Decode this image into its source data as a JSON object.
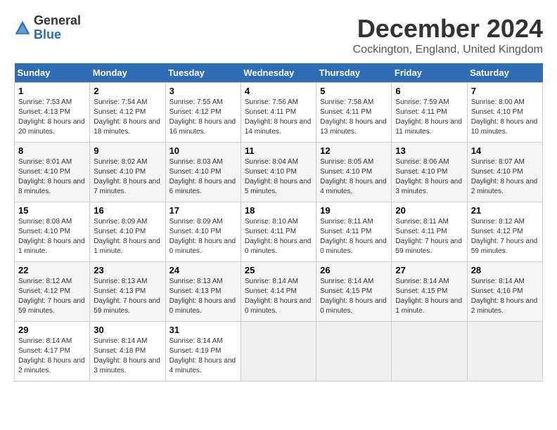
{
  "header": {
    "logo_general": "General",
    "logo_blue": "Blue",
    "month_title": "December 2024",
    "location": "Cockington, England, United Kingdom"
  },
  "days_of_week": [
    "Sunday",
    "Monday",
    "Tuesday",
    "Wednesday",
    "Thursday",
    "Friday",
    "Saturday"
  ],
  "weeks": [
    [
      {
        "day": "1",
        "sunrise": "Sunrise: 7:53 AM",
        "sunset": "Sunset: 4:13 PM",
        "daylight": "Daylight: 8 hours and 20 minutes."
      },
      {
        "day": "2",
        "sunrise": "Sunrise: 7:54 AM",
        "sunset": "Sunset: 4:12 PM",
        "daylight": "Daylight: 8 hours and 18 minutes."
      },
      {
        "day": "3",
        "sunrise": "Sunrise: 7:55 AM",
        "sunset": "Sunset: 4:12 PM",
        "daylight": "Daylight: 8 hours and 16 minutes."
      },
      {
        "day": "4",
        "sunrise": "Sunrise: 7:56 AM",
        "sunset": "Sunset: 4:11 PM",
        "daylight": "Daylight: 8 hours and 14 minutes."
      },
      {
        "day": "5",
        "sunrise": "Sunrise: 7:58 AM",
        "sunset": "Sunset: 4:11 PM",
        "daylight": "Daylight: 8 hours and 13 minutes."
      },
      {
        "day": "6",
        "sunrise": "Sunrise: 7:59 AM",
        "sunset": "Sunset: 4:11 PM",
        "daylight": "Daylight: 8 hours and 11 minutes."
      },
      {
        "day": "7",
        "sunrise": "Sunrise: 8:00 AM",
        "sunset": "Sunset: 4:10 PM",
        "daylight": "Daylight: 8 hours and 10 minutes."
      }
    ],
    [
      {
        "day": "8",
        "sunrise": "Sunrise: 8:01 AM",
        "sunset": "Sunset: 4:10 PM",
        "daylight": "Daylight: 8 hours and 8 minutes."
      },
      {
        "day": "9",
        "sunrise": "Sunrise: 8:02 AM",
        "sunset": "Sunset: 4:10 PM",
        "daylight": "Daylight: 8 hours and 7 minutes."
      },
      {
        "day": "10",
        "sunrise": "Sunrise: 8:03 AM",
        "sunset": "Sunset: 4:10 PM",
        "daylight": "Daylight: 8 hours and 6 minutes."
      },
      {
        "day": "11",
        "sunrise": "Sunrise: 8:04 AM",
        "sunset": "Sunset: 4:10 PM",
        "daylight": "Daylight: 8 hours and 5 minutes."
      },
      {
        "day": "12",
        "sunrise": "Sunrise: 8:05 AM",
        "sunset": "Sunset: 4:10 PM",
        "daylight": "Daylight: 8 hours and 4 minutes."
      },
      {
        "day": "13",
        "sunrise": "Sunrise: 8:06 AM",
        "sunset": "Sunset: 4:10 PM",
        "daylight": "Daylight: 8 hours and 3 minutes."
      },
      {
        "day": "14",
        "sunrise": "Sunrise: 8:07 AM",
        "sunset": "Sunset: 4:10 PM",
        "daylight": "Daylight: 8 hours and 2 minutes."
      }
    ],
    [
      {
        "day": "15",
        "sunrise": "Sunrise: 8:08 AM",
        "sunset": "Sunset: 4:10 PM",
        "daylight": "Daylight: 8 hours and 1 minute."
      },
      {
        "day": "16",
        "sunrise": "Sunrise: 8:09 AM",
        "sunset": "Sunset: 4:10 PM",
        "daylight": "Daylight: 8 hours and 1 minute."
      },
      {
        "day": "17",
        "sunrise": "Sunrise: 8:09 AM",
        "sunset": "Sunset: 4:10 PM",
        "daylight": "Daylight: 8 hours and 0 minutes."
      },
      {
        "day": "18",
        "sunrise": "Sunrise: 8:10 AM",
        "sunset": "Sunset: 4:11 PM",
        "daylight": "Daylight: 8 hours and 0 minutes."
      },
      {
        "day": "19",
        "sunrise": "Sunrise: 8:11 AM",
        "sunset": "Sunset: 4:11 PM",
        "daylight": "Daylight: 8 hours and 0 minutes."
      },
      {
        "day": "20",
        "sunrise": "Sunrise: 8:11 AM",
        "sunset": "Sunset: 4:11 PM",
        "daylight": "Daylight: 7 hours and 59 minutes."
      },
      {
        "day": "21",
        "sunrise": "Sunrise: 8:12 AM",
        "sunset": "Sunset: 4:12 PM",
        "daylight": "Daylight: 7 hours and 59 minutes."
      }
    ],
    [
      {
        "day": "22",
        "sunrise": "Sunrise: 8:12 AM",
        "sunset": "Sunset: 4:12 PM",
        "daylight": "Daylight: 7 hours and 59 minutes."
      },
      {
        "day": "23",
        "sunrise": "Sunrise: 8:13 AM",
        "sunset": "Sunset: 4:13 PM",
        "daylight": "Daylight: 7 hours and 59 minutes."
      },
      {
        "day": "24",
        "sunrise": "Sunrise: 8:13 AM",
        "sunset": "Sunset: 4:13 PM",
        "daylight": "Daylight: 8 hours and 0 minutes."
      },
      {
        "day": "25",
        "sunrise": "Sunrise: 8:14 AM",
        "sunset": "Sunset: 4:14 PM",
        "daylight": "Daylight: 8 hours and 0 minutes."
      },
      {
        "day": "26",
        "sunrise": "Sunrise: 8:14 AM",
        "sunset": "Sunset: 4:15 PM",
        "daylight": "Daylight: 8 hours and 0 minutes."
      },
      {
        "day": "27",
        "sunrise": "Sunrise: 8:14 AM",
        "sunset": "Sunset: 4:15 PM",
        "daylight": "Daylight: 8 hours and 1 minute."
      },
      {
        "day": "28",
        "sunrise": "Sunrise: 8:14 AM",
        "sunset": "Sunset: 4:16 PM",
        "daylight": "Daylight: 8 hours and 2 minutes."
      }
    ],
    [
      {
        "day": "29",
        "sunrise": "Sunrise: 8:14 AM",
        "sunset": "Sunset: 4:17 PM",
        "daylight": "Daylight: 8 hours and 2 minutes."
      },
      {
        "day": "30",
        "sunrise": "Sunrise: 8:14 AM",
        "sunset": "Sunset: 4:18 PM",
        "daylight": "Daylight: 8 hours and 3 minutes."
      },
      {
        "day": "31",
        "sunrise": "Sunrise: 8:14 AM",
        "sunset": "Sunset: 4:19 PM",
        "daylight": "Daylight: 8 hours and 4 minutes."
      },
      null,
      null,
      null,
      null
    ]
  ]
}
